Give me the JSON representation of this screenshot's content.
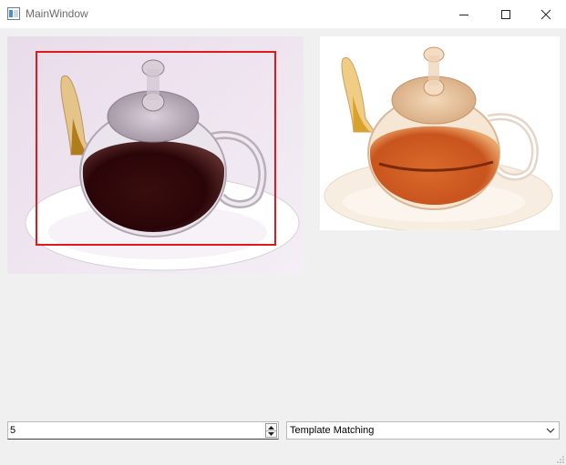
{
  "window": {
    "title": "MainWindow"
  },
  "images": {
    "left": {
      "description_icon": "teapot-image-icon"
    },
    "right": {
      "description_icon": "teapot-image-icon"
    }
  },
  "controls": {
    "spinbox_value": "5",
    "combo_selected": "Template Matching"
  },
  "colors": {
    "roi_border": "#e01a1a"
  }
}
